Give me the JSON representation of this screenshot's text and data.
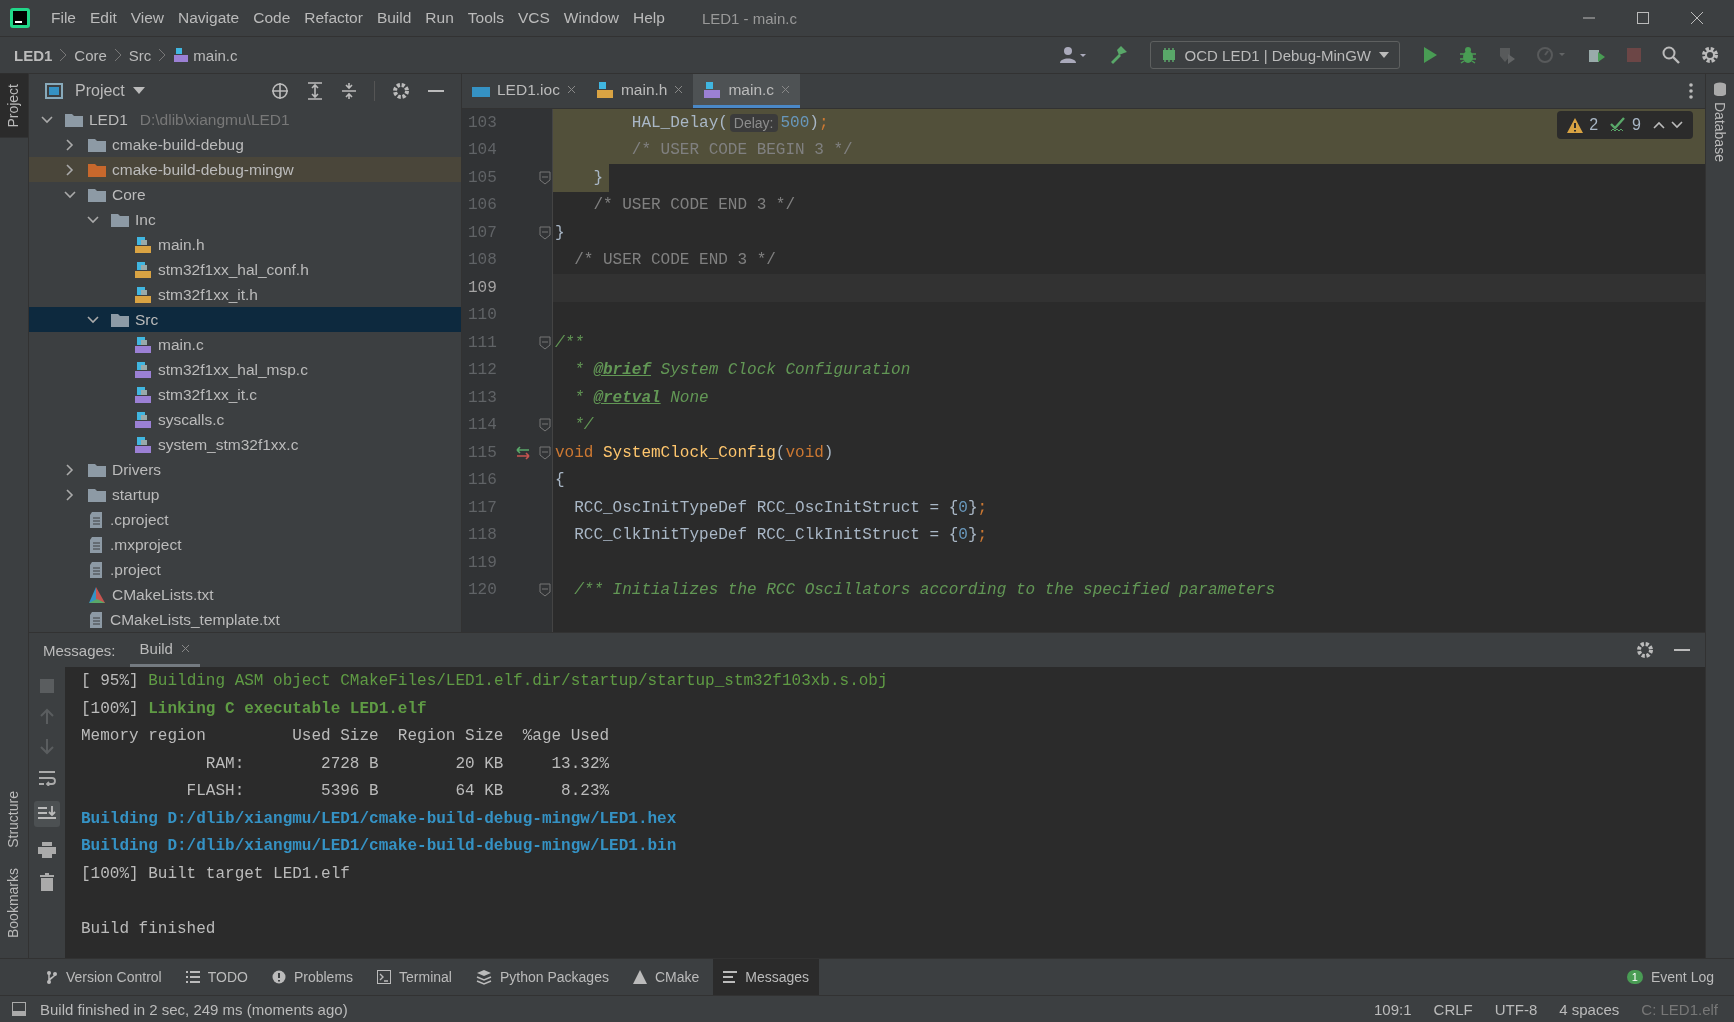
{
  "menu": {
    "items": [
      "File",
      "Edit",
      "View",
      "Navigate",
      "Code",
      "Refactor",
      "Build",
      "Run",
      "Tools",
      "VCS",
      "Window",
      "Help"
    ],
    "window_title": "LED1 - main.c"
  },
  "breadcrumbs": [
    {
      "label": "LED1",
      "kind": "project"
    },
    {
      "label": "Core",
      "kind": "folder"
    },
    {
      "label": "Src",
      "kind": "folder"
    },
    {
      "label": "main.c",
      "kind": "c"
    }
  ],
  "toolbar": {
    "left": [
      {
        "kind": "user",
        "disabled": false
      },
      {
        "kind": "build",
        "disabled": false
      }
    ],
    "run_config": "OCD LED1 | Debug-MinGW",
    "actions": [
      {
        "kind": "run",
        "disabled": false
      },
      {
        "kind": "debug",
        "disabled": false
      },
      {
        "kind": "coverage",
        "disabled": true
      },
      {
        "kind": "profile",
        "disabled": true
      },
      {
        "kind": "attach",
        "disabled": false
      },
      {
        "kind": "stop",
        "disabled": true
      }
    ]
  },
  "left_strip": [
    {
      "label": "Project",
      "selected": true
    },
    {
      "label": "Structure",
      "selected": false
    },
    {
      "label": "Bookmarks",
      "selected": false
    }
  ],
  "right_strip": [
    {
      "label": "Database",
      "selected": false
    }
  ],
  "project": {
    "title": "Project",
    "tree": [
      {
        "label": "LED1",
        "hint": "D:\\dlib\\xiangmu\\LED1",
        "kind": "folder",
        "expanded": true,
        "selected": false,
        "children": [
          {
            "label": "cmake-build-debug",
            "kind": "folder",
            "expanded": false,
            "selected": false
          },
          {
            "label": "cmake-build-debug-mingw",
            "kind": "excluded",
            "expanded": false,
            "selected": false
          },
          {
            "label": "Core",
            "kind": "folder",
            "expanded": true,
            "selected": false,
            "children": [
              {
                "label": "Inc",
                "kind": "folder",
                "expanded": true,
                "selected": false,
                "children": [
                  {
                    "label": "main.h",
                    "kind": "h",
                    "selected": false
                  },
                  {
                    "label": "stm32f1xx_hal_conf.h",
                    "kind": "h",
                    "selected": false
                  },
                  {
                    "label": "stm32f1xx_it.h",
                    "kind": "h",
                    "selected": false
                  }
                ]
              },
              {
                "label": "Src",
                "kind": "folder",
                "expanded": true,
                "selected": true,
                "children": [
                  {
                    "label": "main.c",
                    "kind": "c",
                    "selected": false
                  },
                  {
                    "label": "stm32f1xx_hal_msp.c",
                    "kind": "c",
                    "selected": false
                  },
                  {
                    "label": "stm32f1xx_it.c",
                    "kind": "c",
                    "selected": false
                  },
                  {
                    "label": "syscalls.c",
                    "kind": "c",
                    "selected": false
                  },
                  {
                    "label": "system_stm32f1xx.c",
                    "kind": "c",
                    "selected": false
                  }
                ]
              }
            ]
          },
          {
            "label": "Drivers",
            "kind": "folder",
            "expanded": false,
            "selected": false
          },
          {
            "label": "startup",
            "kind": "folder",
            "expanded": false,
            "selected": false
          },
          {
            "label": ".cproject",
            "kind": "file",
            "selected": false
          },
          {
            "label": ".mxproject",
            "kind": "file",
            "selected": false
          },
          {
            "label": ".project",
            "kind": "file",
            "selected": false
          },
          {
            "label": "CMakeLists.txt",
            "kind": "cmake",
            "selected": false
          },
          {
            "label": "CMakeLists_template.txt",
            "kind": "file",
            "selected": false
          }
        ]
      }
    ]
  },
  "editor": {
    "tabs": [
      {
        "label": "LED1.ioc",
        "kind": "ioc",
        "selected": false
      },
      {
        "label": "main.h",
        "kind": "h",
        "selected": false
      },
      {
        "label": "main.c",
        "kind": "c",
        "selected": true
      }
    ],
    "inspections": {
      "warnings": "2",
      "typos": "9"
    },
    "lines": [
      {
        "number": "103",
        "highlighted": true,
        "full_width": true,
        "current": false,
        "fold": false,
        "marker": false,
        "tokens": [
          {
            "kind": "text",
            "text": "        HAL_Delay("
          },
          {
            "kind": "hint",
            "text": "Delay:"
          },
          {
            "kind": "number",
            "text": "500"
          },
          {
            "kind": "text",
            "text": ")"
          },
          {
            "kind": "punct",
            "text": ";"
          }
        ]
      },
      {
        "number": "104",
        "highlighted": true,
        "full_width": true,
        "current": false,
        "fold": false,
        "marker": false,
        "tokens": [
          {
            "kind": "comment",
            "text": "        /* USER CODE BEGIN 3 */"
          }
        ]
      },
      {
        "number": "105",
        "highlighted": true,
        "full_width": false,
        "current": false,
        "fold": true,
        "marker": false,
        "tokens": [
          {
            "kind": "text",
            "text": "    }"
          }
        ]
      },
      {
        "number": "106",
        "highlighted": false,
        "current": false,
        "fold": false,
        "marker": false,
        "tokens": [
          {
            "kind": "comment",
            "text": "    /* USER CODE END 3 */"
          }
        ]
      },
      {
        "number": "107",
        "highlighted": false,
        "current": false,
        "fold": true,
        "marker": false,
        "tokens": [
          {
            "kind": "text",
            "text": "}"
          }
        ]
      },
      {
        "number": "108",
        "highlighted": false,
        "current": false,
        "fold": false,
        "marker": false,
        "tokens": [
          {
            "kind": "comment",
            "text": "  /* USER CODE END 3 */"
          }
        ]
      },
      {
        "number": "109",
        "highlighted": false,
        "current": true,
        "fold": false,
        "marker": false
      },
      {
        "number": "110",
        "highlighted": false,
        "current": false,
        "fold": false,
        "marker": false
      },
      {
        "number": "111",
        "highlighted": false,
        "current": false,
        "fold": true,
        "marker": false,
        "tokens": [
          {
            "kind": "doc",
            "text": "/**"
          }
        ]
      },
      {
        "number": "112",
        "highlighted": false,
        "current": false,
        "fold": false,
        "marker": false,
        "tokens": [
          {
            "kind": "doc",
            "text": "  * "
          },
          {
            "kind": "tag",
            "text": "@brief"
          },
          {
            "kind": "doc",
            "text": " System Clock Configuration"
          }
        ]
      },
      {
        "number": "113",
        "highlighted": false,
        "current": false,
        "fold": false,
        "marker": false,
        "tokens": [
          {
            "kind": "doc",
            "text": "  * "
          },
          {
            "kind": "tag",
            "text": "@retval"
          },
          {
            "kind": "doc",
            "text": " None"
          }
        ]
      },
      {
        "number": "114",
        "highlighted": false,
        "current": false,
        "fold": true,
        "marker": false,
        "tokens": [
          {
            "kind": "doc",
            "text": "  */"
          }
        ]
      },
      {
        "number": "115",
        "highlighted": false,
        "current": false,
        "fold": true,
        "marker": true,
        "tokens": [
          {
            "kind": "keyword",
            "text": "void"
          },
          {
            "kind": "func",
            "text": " SystemClock_Config"
          },
          {
            "kind": "text",
            "text": "("
          },
          {
            "kind": "keyword",
            "text": "void"
          },
          {
            "kind": "text",
            "text": ")"
          }
        ]
      },
      {
        "number": "116",
        "highlighted": false,
        "current": false,
        "fold": false,
        "marker": false,
        "tokens": [
          {
            "kind": "text",
            "text": "{"
          }
        ]
      },
      {
        "number": "117",
        "highlighted": false,
        "current": false,
        "fold": false,
        "marker": false,
        "tokens": [
          {
            "kind": "text",
            "text": "  RCC_OscInitTypeDef RCC_OscInitStruct = {"
          },
          {
            "kind": "number",
            "text": "0"
          },
          {
            "kind": "text",
            "text": "}"
          },
          {
            "kind": "punct",
            "text": ";"
          }
        ]
      },
      {
        "number": "118",
        "highlighted": false,
        "current": false,
        "fold": false,
        "marker": false,
        "tokens": [
          {
            "kind": "text",
            "text": "  RCC_ClkInitTypeDef RCC_ClkInitStruct = {"
          },
          {
            "kind": "number",
            "text": "0"
          },
          {
            "kind": "text",
            "text": "}"
          },
          {
            "kind": "punct",
            "text": ";"
          }
        ]
      },
      {
        "number": "119",
        "highlighted": false,
        "current": false,
        "fold": false,
        "marker": false
      },
      {
        "number": "120",
        "highlighted": false,
        "current": false,
        "fold": true,
        "marker": false,
        "tokens": [
          {
            "kind": "doc",
            "text": "  /** Initializes the RCC Oscillators according to the specified parameters"
          }
        ]
      }
    ]
  },
  "messages": {
    "label": "Messages:",
    "tabs": [
      {
        "label": "Build",
        "selected": true
      }
    ],
    "lines": [
      {
        "blank_before": false,
        "tokens": [
          {
            "kind": "plain",
            "text": "[ 95%] "
          },
          {
            "kind": "green",
            "text": "Building ASM object CMakeFiles/LED1.elf.dir/startup/startup_stm32f103xb.s.obj"
          }
        ]
      },
      {
        "blank_before": false,
        "tokens": [
          {
            "kind": "plain",
            "text": "[100%] "
          },
          {
            "kind": "green-bold",
            "text": "Linking C executable LED1.elf"
          }
        ]
      },
      {
        "blank_before": false,
        "tokens": [
          {
            "kind": "plain",
            "text": "Memory region         Used Size  Region Size  %age Used"
          }
        ]
      },
      {
        "blank_before": false,
        "tokens": [
          {
            "kind": "plain",
            "text": "             RAM:        2728 B        20 KB     13.32%"
          }
        ]
      },
      {
        "blank_before": false,
        "tokens": [
          {
            "kind": "plain",
            "text": "           FLASH:        5396 B        64 KB      8.23%"
          }
        ]
      },
      {
        "blank_before": false,
        "tokens": [
          {
            "kind": "blue",
            "text": "Building D:/dlib/xiangmu/LED1/cmake-build-debug-mingw/LED1.hex"
          }
        ]
      },
      {
        "blank_before": false,
        "tokens": [
          {
            "kind": "blue",
            "text": "Building D:/dlib/xiangmu/LED1/cmake-build-debug-mingw/LED1.bin"
          }
        ]
      },
      {
        "blank_before": false,
        "tokens": [
          {
            "kind": "plain",
            "text": "[100%] Built target LED1.elf"
          }
        ]
      },
      {
        "blank_before": true,
        "tokens": [
          {
            "kind": "plain",
            "text": "Build finished"
          }
        ]
      }
    ]
  },
  "tool_windows": [
    {
      "label": "Version Control",
      "kind": "vcs",
      "selected": false
    },
    {
      "label": "TODO",
      "kind": "todo",
      "selected": false
    },
    {
      "label": "Problems",
      "kind": "problems",
      "selected": false
    },
    {
      "label": "Terminal",
      "kind": "terminal",
      "selected": false
    },
    {
      "label": "Python Packages",
      "kind": "packages",
      "selected": false
    },
    {
      "label": "CMake",
      "kind": "cmake",
      "selected": false
    },
    {
      "label": "Messages",
      "kind": "messages",
      "selected": true
    }
  ],
  "event_log": {
    "label": "Event Log",
    "count": "1"
  },
  "status": {
    "message": "Build finished in 2 sec, 249 ms (moments ago)",
    "items": [
      {
        "text": "109:1",
        "disabled": false
      },
      {
        "text": "CRLF",
        "disabled": false
      },
      {
        "text": "UTF-8",
        "disabled": false
      },
      {
        "text": "4 spaces",
        "disabled": false
      },
      {
        "text": "C: LED1.elf",
        "disabled": true
      }
    ]
  }
}
